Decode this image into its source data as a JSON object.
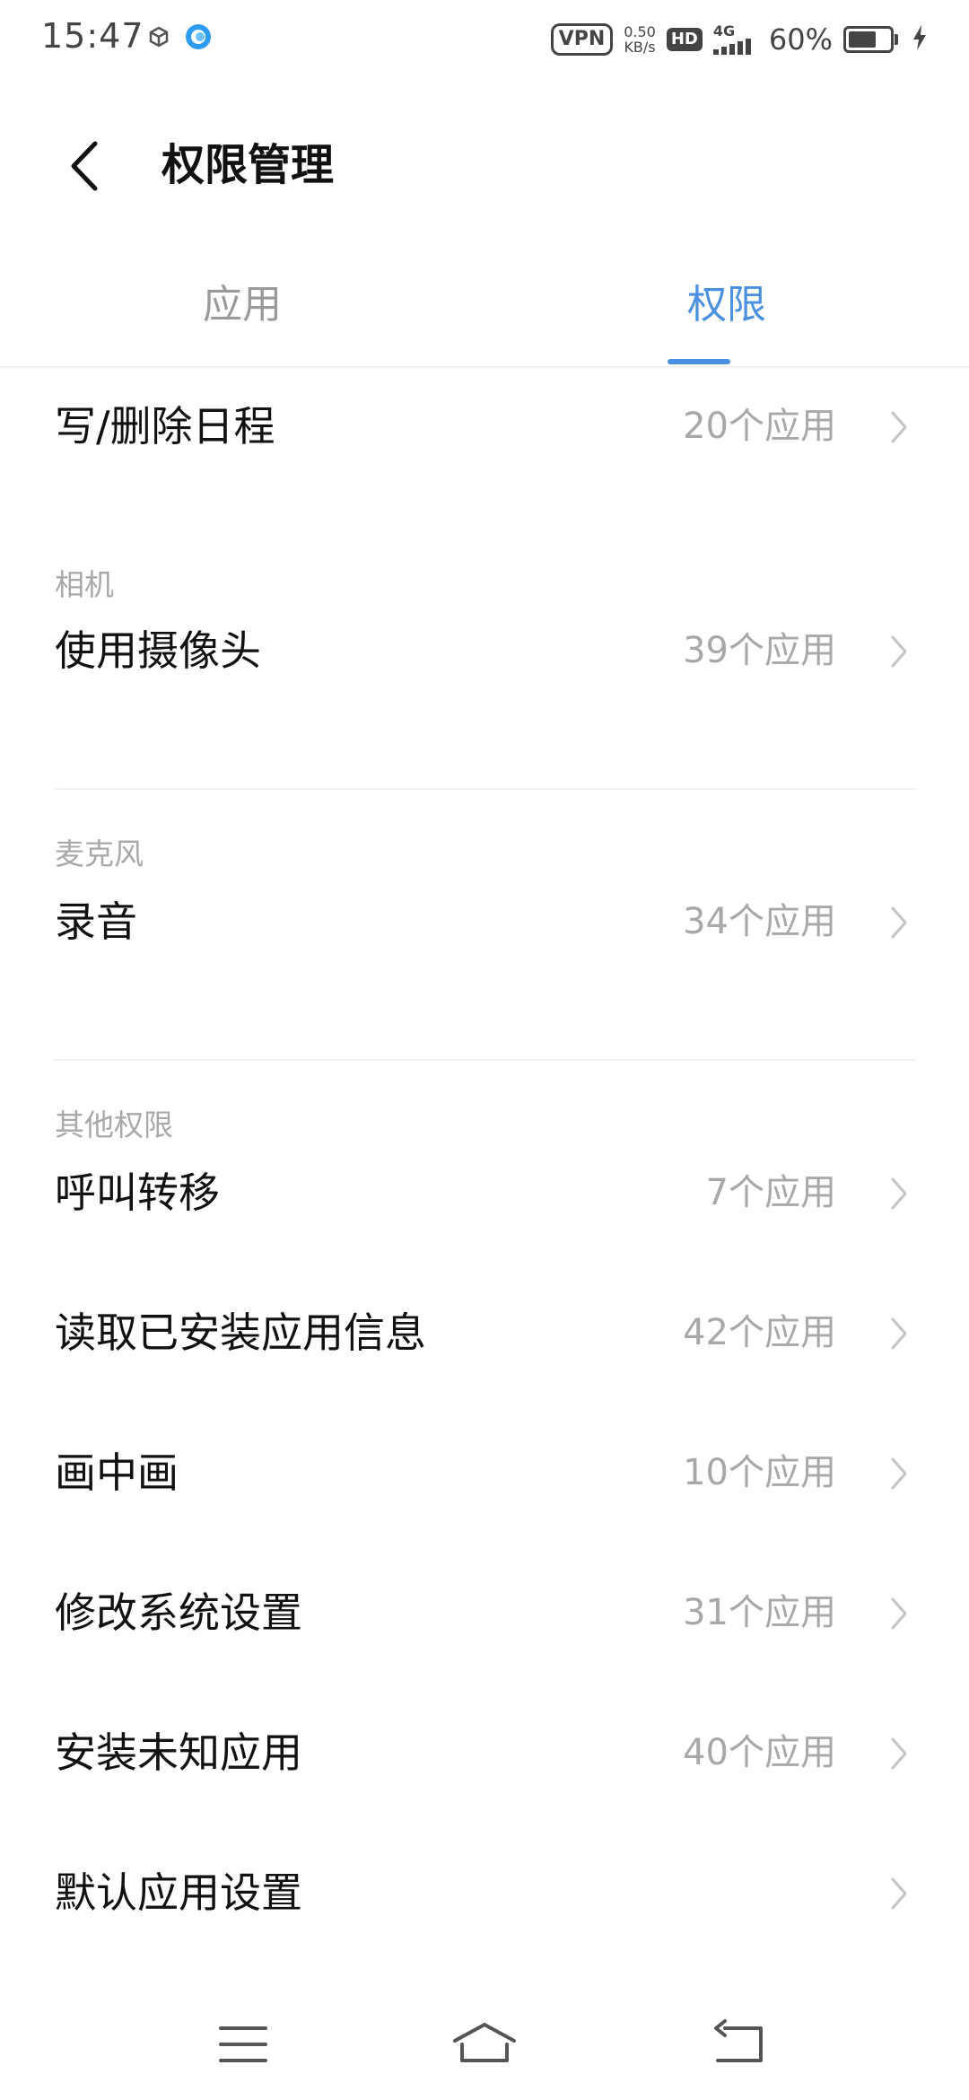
{
  "status_bar": {
    "time": "15:47",
    "vpn": "VPN",
    "net_speed_value": "0.50",
    "net_speed_unit": "KB/s",
    "hd": "HD",
    "network": "4G",
    "battery_percent": "60%",
    "battery_level": 0.6
  },
  "header": {
    "title": "权限管理"
  },
  "tabs": {
    "apps": "应用",
    "permissions": "权限",
    "active": "permissions",
    "accent_color": "#4a90e2"
  },
  "list": {
    "calendar_write": {
      "label": "写/删除日程",
      "count": "20个应用"
    },
    "camera_section": "相机",
    "camera": {
      "label": "使用摄像头",
      "count": "39个应用"
    },
    "mic_section": "麦克风",
    "record_audio": {
      "label": "录音",
      "count": "34个应用"
    },
    "other_section": "其他权限",
    "call_forwarding": {
      "label": "呼叫转移",
      "count": "7个应用"
    },
    "read_installed_apps": {
      "label": "读取已安装应用信息",
      "count": "42个应用"
    },
    "pip": {
      "label": "画中画",
      "count": "10个应用"
    },
    "modify_system_settings": {
      "label": "修改系统设置",
      "count": "31个应用"
    },
    "install_unknown_apps": {
      "label": "安装未知应用",
      "count": "40个应用"
    },
    "default_apps": {
      "label": "默认应用设置"
    }
  },
  "nav_bar": {
    "icons": [
      "menu-icon",
      "home-icon",
      "back-icon"
    ]
  }
}
